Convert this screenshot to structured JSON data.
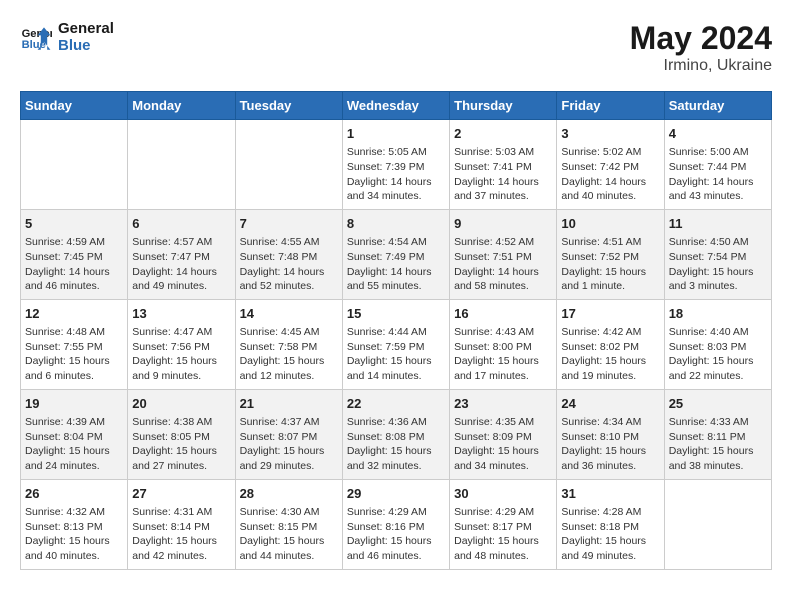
{
  "header": {
    "logo_line1": "General",
    "logo_line2": "Blue",
    "main_title": "May 2024",
    "subtitle": "Irmino, Ukraine"
  },
  "weekdays": [
    "Sunday",
    "Monday",
    "Tuesday",
    "Wednesday",
    "Thursday",
    "Friday",
    "Saturday"
  ],
  "weeks": [
    [
      {
        "day": "",
        "info": ""
      },
      {
        "day": "",
        "info": ""
      },
      {
        "day": "",
        "info": ""
      },
      {
        "day": "1",
        "info": "Sunrise: 5:05 AM\nSunset: 7:39 PM\nDaylight: 14 hours\nand 34 minutes."
      },
      {
        "day": "2",
        "info": "Sunrise: 5:03 AM\nSunset: 7:41 PM\nDaylight: 14 hours\nand 37 minutes."
      },
      {
        "day": "3",
        "info": "Sunrise: 5:02 AM\nSunset: 7:42 PM\nDaylight: 14 hours\nand 40 minutes."
      },
      {
        "day": "4",
        "info": "Sunrise: 5:00 AM\nSunset: 7:44 PM\nDaylight: 14 hours\nand 43 minutes."
      }
    ],
    [
      {
        "day": "5",
        "info": "Sunrise: 4:59 AM\nSunset: 7:45 PM\nDaylight: 14 hours\nand 46 minutes."
      },
      {
        "day": "6",
        "info": "Sunrise: 4:57 AM\nSunset: 7:47 PM\nDaylight: 14 hours\nand 49 minutes."
      },
      {
        "day": "7",
        "info": "Sunrise: 4:55 AM\nSunset: 7:48 PM\nDaylight: 14 hours\nand 52 minutes."
      },
      {
        "day": "8",
        "info": "Sunrise: 4:54 AM\nSunset: 7:49 PM\nDaylight: 14 hours\nand 55 minutes."
      },
      {
        "day": "9",
        "info": "Sunrise: 4:52 AM\nSunset: 7:51 PM\nDaylight: 14 hours\nand 58 minutes."
      },
      {
        "day": "10",
        "info": "Sunrise: 4:51 AM\nSunset: 7:52 PM\nDaylight: 15 hours\nand 1 minute."
      },
      {
        "day": "11",
        "info": "Sunrise: 4:50 AM\nSunset: 7:54 PM\nDaylight: 15 hours\nand 3 minutes."
      }
    ],
    [
      {
        "day": "12",
        "info": "Sunrise: 4:48 AM\nSunset: 7:55 PM\nDaylight: 15 hours\nand 6 minutes."
      },
      {
        "day": "13",
        "info": "Sunrise: 4:47 AM\nSunset: 7:56 PM\nDaylight: 15 hours\nand 9 minutes."
      },
      {
        "day": "14",
        "info": "Sunrise: 4:45 AM\nSunset: 7:58 PM\nDaylight: 15 hours\nand 12 minutes."
      },
      {
        "day": "15",
        "info": "Sunrise: 4:44 AM\nSunset: 7:59 PM\nDaylight: 15 hours\nand 14 minutes."
      },
      {
        "day": "16",
        "info": "Sunrise: 4:43 AM\nSunset: 8:00 PM\nDaylight: 15 hours\nand 17 minutes."
      },
      {
        "day": "17",
        "info": "Sunrise: 4:42 AM\nSunset: 8:02 PM\nDaylight: 15 hours\nand 19 minutes."
      },
      {
        "day": "18",
        "info": "Sunrise: 4:40 AM\nSunset: 8:03 PM\nDaylight: 15 hours\nand 22 minutes."
      }
    ],
    [
      {
        "day": "19",
        "info": "Sunrise: 4:39 AM\nSunset: 8:04 PM\nDaylight: 15 hours\nand 24 minutes."
      },
      {
        "day": "20",
        "info": "Sunrise: 4:38 AM\nSunset: 8:05 PM\nDaylight: 15 hours\nand 27 minutes."
      },
      {
        "day": "21",
        "info": "Sunrise: 4:37 AM\nSunset: 8:07 PM\nDaylight: 15 hours\nand 29 minutes."
      },
      {
        "day": "22",
        "info": "Sunrise: 4:36 AM\nSunset: 8:08 PM\nDaylight: 15 hours\nand 32 minutes."
      },
      {
        "day": "23",
        "info": "Sunrise: 4:35 AM\nSunset: 8:09 PM\nDaylight: 15 hours\nand 34 minutes."
      },
      {
        "day": "24",
        "info": "Sunrise: 4:34 AM\nSunset: 8:10 PM\nDaylight: 15 hours\nand 36 minutes."
      },
      {
        "day": "25",
        "info": "Sunrise: 4:33 AM\nSunset: 8:11 PM\nDaylight: 15 hours\nand 38 minutes."
      }
    ],
    [
      {
        "day": "26",
        "info": "Sunrise: 4:32 AM\nSunset: 8:13 PM\nDaylight: 15 hours\nand 40 minutes."
      },
      {
        "day": "27",
        "info": "Sunrise: 4:31 AM\nSunset: 8:14 PM\nDaylight: 15 hours\nand 42 minutes."
      },
      {
        "day": "28",
        "info": "Sunrise: 4:30 AM\nSunset: 8:15 PM\nDaylight: 15 hours\nand 44 minutes."
      },
      {
        "day": "29",
        "info": "Sunrise: 4:29 AM\nSunset: 8:16 PM\nDaylight: 15 hours\nand 46 minutes."
      },
      {
        "day": "30",
        "info": "Sunrise: 4:29 AM\nSunset: 8:17 PM\nDaylight: 15 hours\nand 48 minutes."
      },
      {
        "day": "31",
        "info": "Sunrise: 4:28 AM\nSunset: 8:18 PM\nDaylight: 15 hours\nand 49 minutes."
      },
      {
        "day": "",
        "info": ""
      }
    ]
  ]
}
